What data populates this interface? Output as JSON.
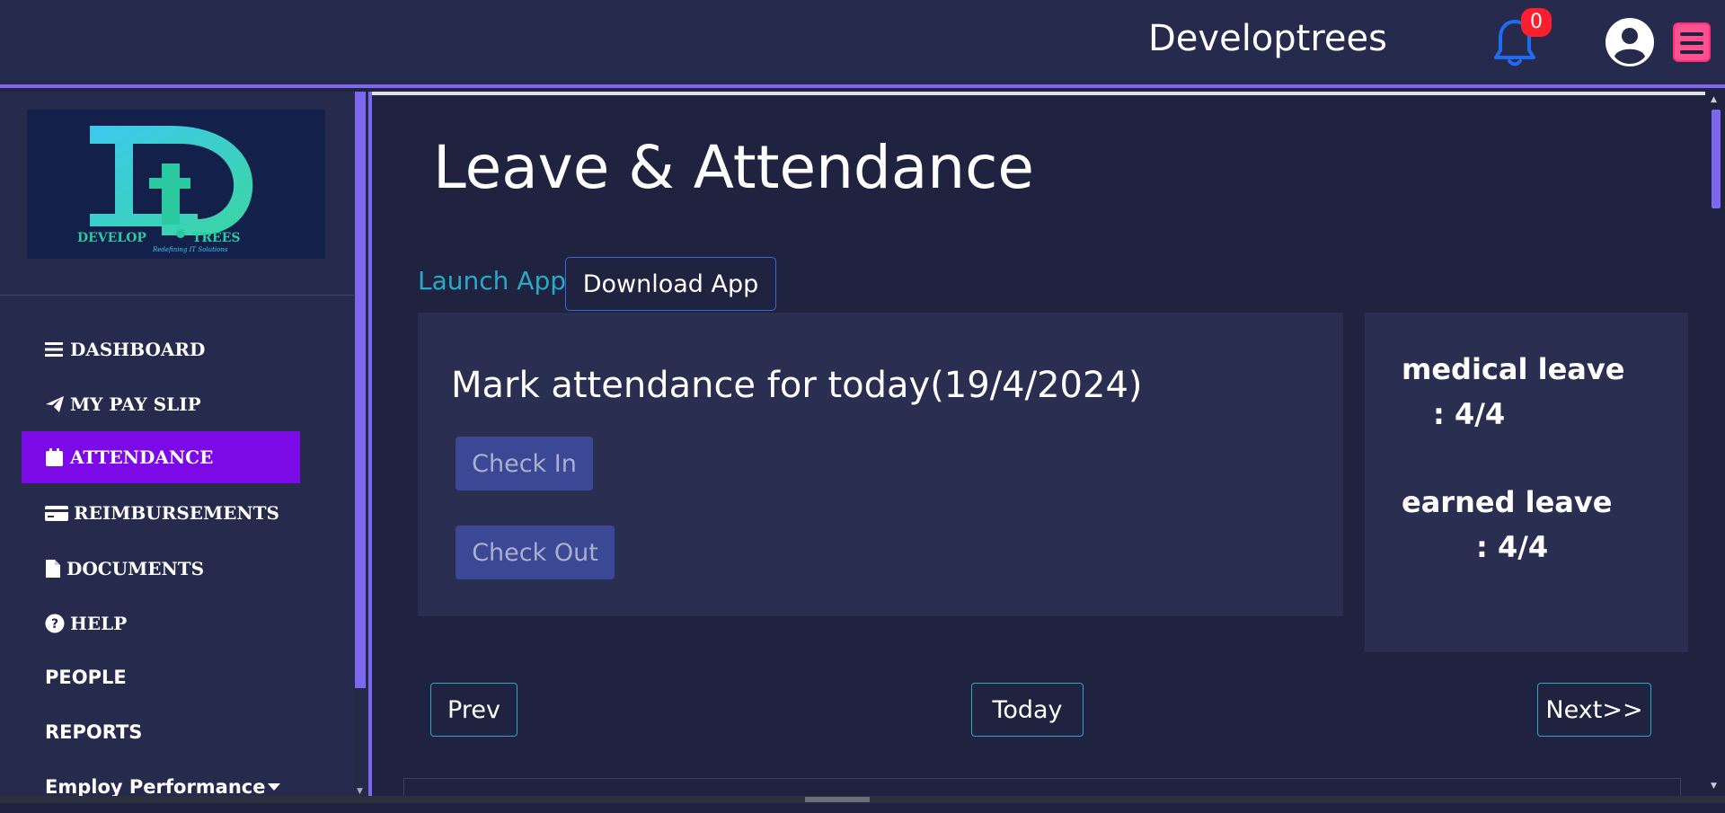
{
  "header": {
    "brand": "Developtrees",
    "notification_count": "0",
    "icons": {
      "bell": "bell-icon",
      "profile": "user-circle-icon",
      "menu": "hamburger-menu-icon"
    },
    "colors": {
      "accent": "#7b68ee",
      "badge": "#ff1e2d",
      "bell": "#1d6cf2",
      "menu": "#ff5090"
    }
  },
  "sidebar": {
    "logo": {
      "word1": "DEVELOP",
      "word2": "TREES",
      "tagline": "Redefining IT Solutions"
    },
    "items": [
      {
        "label": "DASHBOARD",
        "icon": "bars-icon"
      },
      {
        "label": "MY PAY SLIP",
        "icon": "paper-plane-icon"
      },
      {
        "label": "ATTENDANCE",
        "icon": "calendar-icon",
        "active": true
      },
      {
        "label": "REIMBURSEMENTS",
        "icon": "credit-card-icon"
      },
      {
        "label": "DOCUMENTS",
        "icon": "file-icon"
      },
      {
        "label": "HELP",
        "icon": "question-circle-icon"
      },
      {
        "label": "PEOPLE"
      },
      {
        "label": "REPORTS"
      },
      {
        "label": "Employ Performance",
        "icon": "caret-down-icon"
      }
    ],
    "active_color": "#7b0ae6"
  },
  "main": {
    "title": "Leave & Attendance",
    "launch_app": "Launch App",
    "download_app": "Download App",
    "attendance": {
      "title": "Mark attendance for today(19/4/2024)",
      "check_in": "Check In",
      "check_out": "Check Out"
    },
    "leave": [
      {
        "label": "medical leave",
        "value": ":  4/4"
      },
      {
        "label": "earned leave",
        "value": ":  4/4"
      }
    ],
    "pager": {
      "prev": "Prev",
      "today": "Today",
      "next": "Next>>"
    }
  }
}
